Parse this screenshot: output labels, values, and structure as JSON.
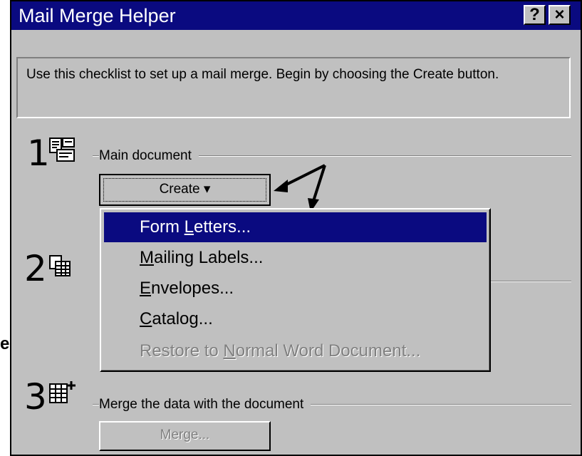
{
  "window": {
    "title": "Mail Merge Helper",
    "help_label": "?",
    "close_label": "×"
  },
  "intro_text": "Use this checklist to set up a mail merge. Begin by choosing the Create button.",
  "steps": [
    {
      "number": "1",
      "label": "Main document",
      "icon": "main-document-icon"
    },
    {
      "number": "2",
      "label": "",
      "icon": "data-source-icon"
    },
    {
      "number": "3",
      "label": "Merge the data with the document",
      "icon": "merge-icon"
    }
  ],
  "create_button": {
    "label": "Create",
    "caret": "▾"
  },
  "merge_button": {
    "label": "Merge..."
  },
  "create_menu": [
    {
      "pre": "Form ",
      "accel": "L",
      "post": "etters...",
      "state": "selected"
    },
    {
      "pre": "",
      "accel": "M",
      "post": "ailing Labels...",
      "state": "normal"
    },
    {
      "pre": "",
      "accel": "E",
      "post": "nvelopes...",
      "state": "normal"
    },
    {
      "pre": "",
      "accel": "C",
      "post": "atalog...",
      "state": "normal"
    },
    {
      "pre": "Restore to ",
      "accel": "N",
      "post": "ormal Word Document...",
      "state": "disabled"
    }
  ],
  "left_edge_char": "e",
  "colors": {
    "titlebar": "#0a0a80",
    "face": "#c0c0c0",
    "highlight": "#0a0a80",
    "disabled_text": "#808080"
  }
}
